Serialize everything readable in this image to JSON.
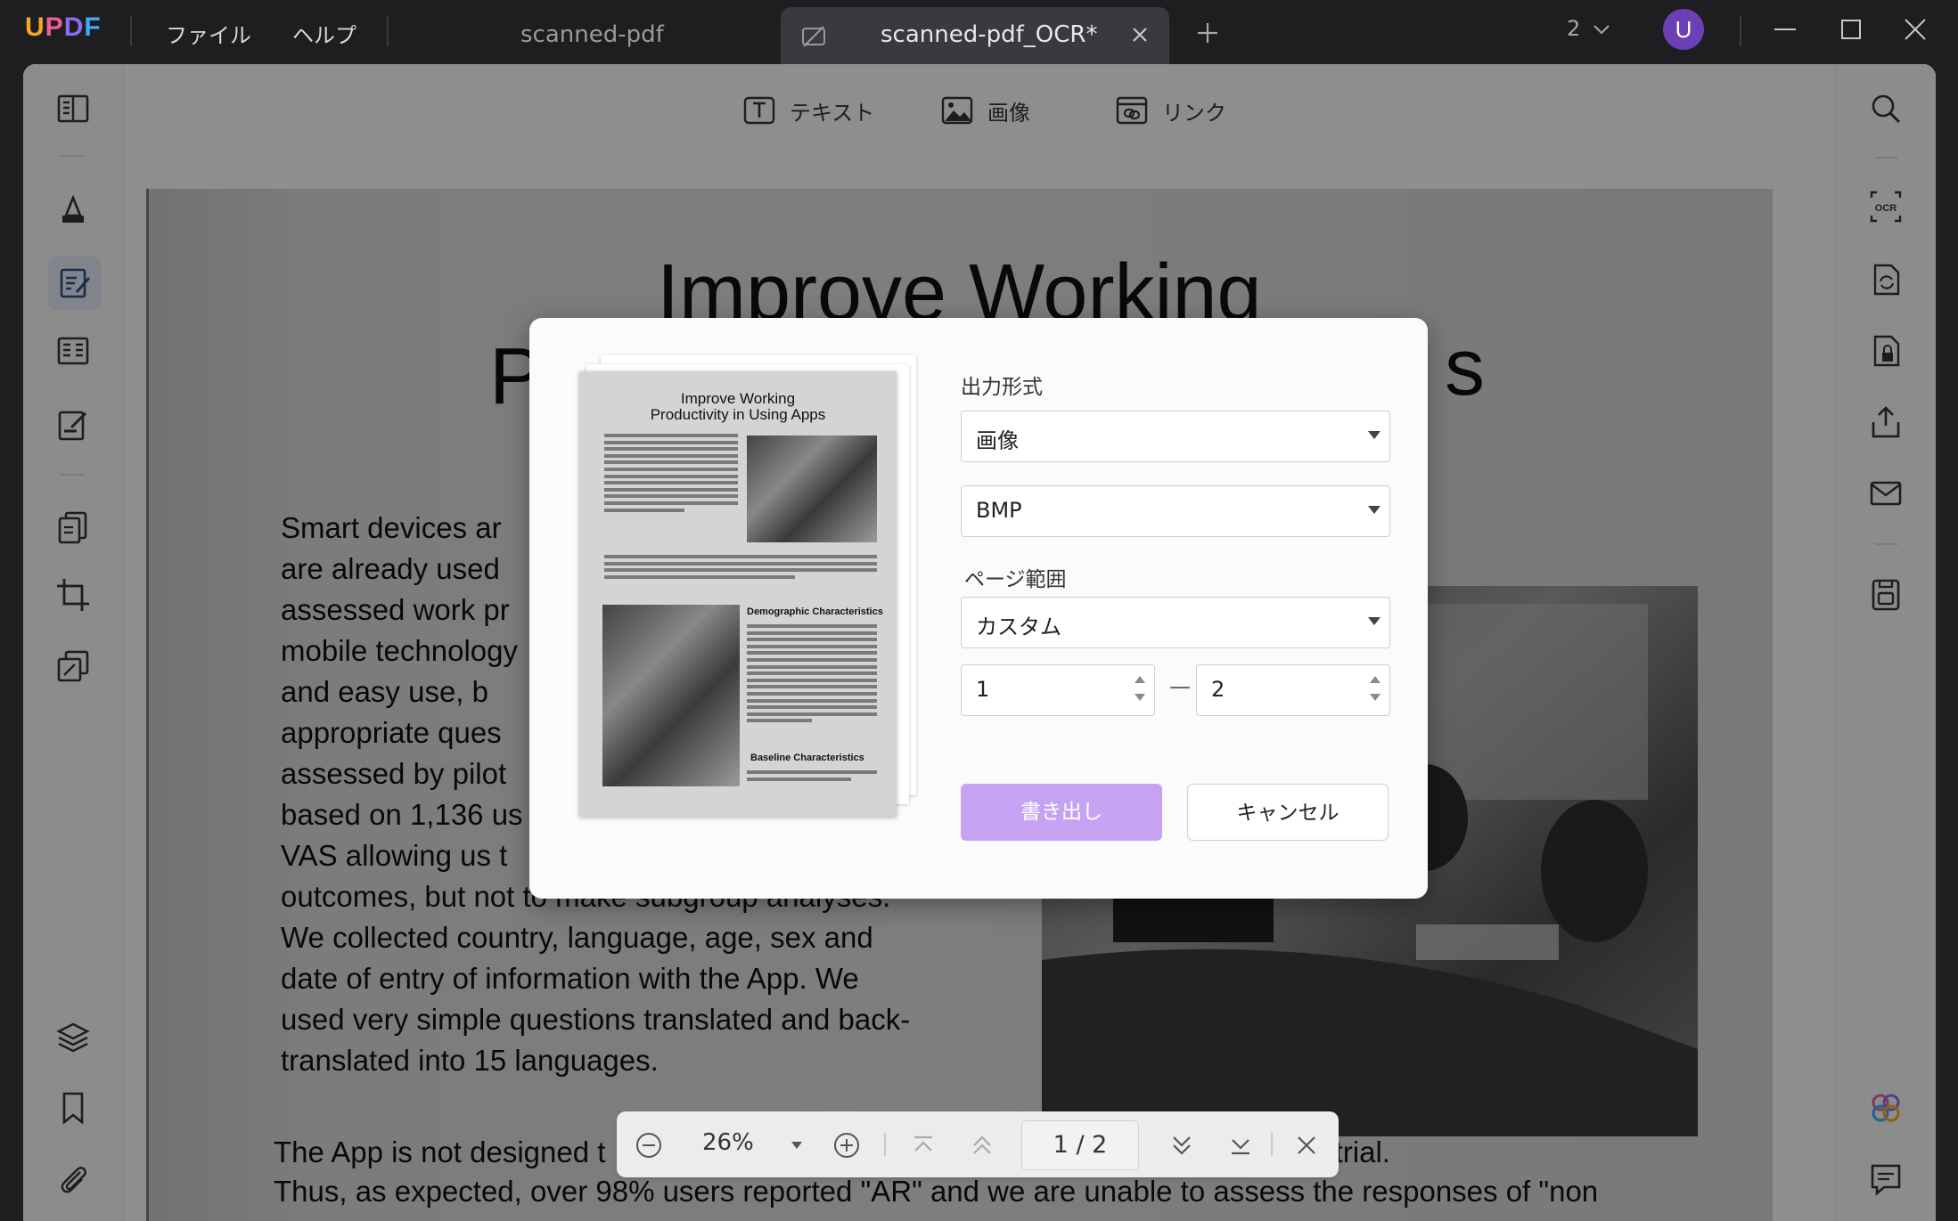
{
  "titlebar": {
    "logo": {
      "u": "U",
      "p": "P",
      "d": "D",
      "f": "F"
    },
    "menu": [
      "ファイル",
      "ヘルプ"
    ],
    "tabs": [
      {
        "label": "scanned-pdf",
        "active": false
      },
      {
        "label": "scanned-pdf_OCR*",
        "active": true
      }
    ],
    "page_count": "2",
    "avatar_initial": "U"
  },
  "toolbar": {
    "text": "テキスト",
    "image": "画像",
    "link": "リンク"
  },
  "document": {
    "title_line1": "Improve Working",
    "title_line2_left": "P",
    "title_line2_right": "s",
    "body": [
      "Smart devices ar",
      "are already used",
      "assessed work pr",
      "mobile technology",
      "and easy use, b",
      "appropriate ques",
      "assessed by pilot",
      "based on 1,136 us",
      "VAS allowing us t",
      "outcomes, but not to make subgroup analyses.",
      "We collected country, language, age, sex and",
      "date of entry of information with the App. We",
      "used very simple questions translated and back-",
      "translated into 15 languages."
    ],
    "bottom_line1_left": "The App is not designed t",
    "bottom_line1_right": "was not a clinical trial.",
    "bottom_line2": "Thus, as expected, over 98% users reported \"AR\" and we are unable to assess the responses of \"non"
  },
  "bottom_nav": {
    "zoom": "26%",
    "current_page": "1",
    "total_pages": "2",
    "page_separator": "/"
  },
  "dialog": {
    "output_format_label": "出力形式",
    "format_value": "画像",
    "image_type_value": "BMP",
    "page_range_label": "ページ範囲",
    "range_mode_value": "カスタム",
    "range_from": "1",
    "range_to": "2",
    "range_dash": "—",
    "export_button": "書き出し",
    "cancel_button": "キャンセル",
    "thumbnail": {
      "title_line1": "Improve Working",
      "title_line2": "Productivity in Using Apps",
      "heading1": "Demographic Characteristics",
      "heading2": "Baseline Characteristics"
    }
  },
  "colors": {
    "accent_purple": "#c6a3f2",
    "avatar": "#6b3fb6",
    "titlebar": "#1e1e20"
  }
}
